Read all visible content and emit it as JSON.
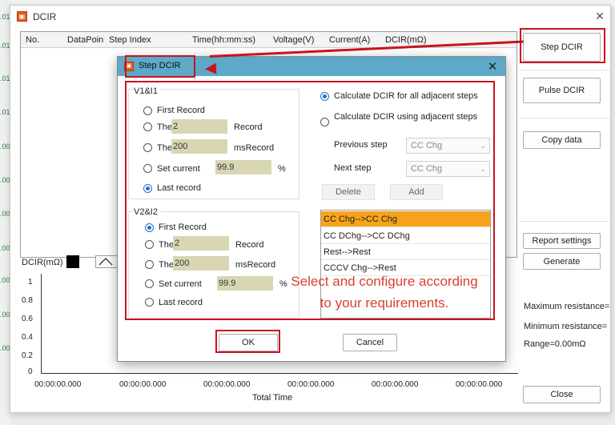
{
  "gutter": {
    "labels": [
      ".01",
      ".01",
      ".01",
      ".01",
      ".00",
      ".00",
      ".00",
      ".00",
      ".00",
      ".00",
      ".00"
    ]
  },
  "main_window": {
    "title": "DCIR",
    "close_glyph": "✕",
    "table": {
      "columns": [
        "No.",
        "DataPoin",
        "Step Index",
        "Time(hh:mm:ss)",
        "Voltage(V)",
        "Current(A)",
        "DCIR(mΩ)"
      ]
    },
    "side_buttons": {
      "step_dcir": "Step DCIR",
      "pulse_dcir": "Pulse DCIR",
      "copy_data": "Copy data",
      "report_settings": "Report settings",
      "generate": "Generate",
      "close": "Close"
    },
    "stats": {
      "max_resistance": "Maximum resistance=",
      "min_resistance": "Minimum resistance=",
      "range": "Range=0.00mΩ"
    },
    "chart": {
      "label": "DCIR(mΩ)",
      "y_ticks": [
        "1",
        "0.8",
        "0.6",
        "0.4",
        "0.2",
        "0"
      ],
      "x_ticks": [
        "00:00:00.000",
        "00:00:00.000",
        "00:00:00.000",
        "00:00:00.000",
        "00:00:00.000",
        "00:00:00.000"
      ],
      "x_label": "Total Time"
    }
  },
  "dialog": {
    "title": "Step DCIR",
    "close_glyph": "✕",
    "v1i1": {
      "title": "V1&I1",
      "first_record": "First Record",
      "the_label": "The",
      "record_count_value": "2",
      "record_suffix": "Record",
      "ms_value": "200",
      "ms_suffix": "msRecord",
      "set_current": "Set current",
      "current_value": "99.9",
      "percent": "%",
      "last_record": "Last record",
      "selected": "last_record"
    },
    "v2i2": {
      "title": "V2&I2",
      "first_record": "First Record",
      "the_label": "The",
      "record_count_value": "2",
      "record_suffix": "Record",
      "ms_value": "200",
      "ms_suffix": "msRecord",
      "set_current": "Set current",
      "current_value": "99.9",
      "percent": "%",
      "last_record": "Last record",
      "selected": "first_record"
    },
    "calc_all": "Calculate DCIR for all adjacent steps",
    "calc_using": "Calculate DCIR using adjacent steps",
    "previous_step_label": "Previous step",
    "previous_step_value": "CC Chg",
    "next_step_label": "Next step",
    "next_step_value": "CC Chg",
    "delete": "Delete",
    "add": "Add",
    "step_pairs": [
      "CC Chg-->CC Chg",
      "CC DChg-->CC DChg",
      "Rest-->Rest",
      "CCCV Chg-->Rest"
    ],
    "selected_pair_index": 0,
    "ok": "OK",
    "cancel": "Cancel"
  },
  "annotation": {
    "line1": "Select and configure according",
    "line2": "to your requirements.",
    "color": "#d9402f",
    "box_color": "#c8141e"
  }
}
